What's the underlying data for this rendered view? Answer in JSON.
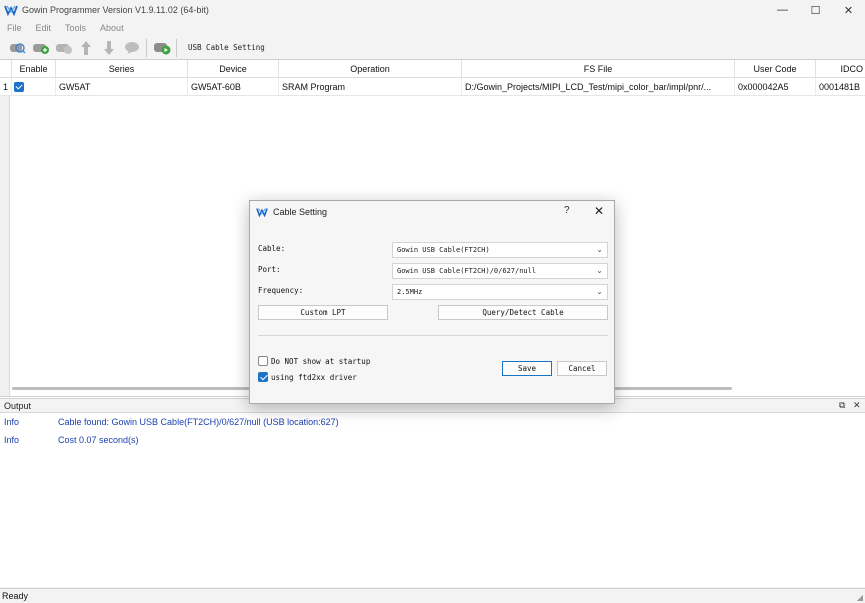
{
  "window": {
    "title": "Gowin Programmer Version V1.9.11.02 (64-bit)",
    "minimize": "—",
    "maximize": "☐",
    "close": "✕"
  },
  "menu": [
    "File",
    "Edit",
    "Tools",
    "About"
  ],
  "toolbar": {
    "label": "USB Cable Setting"
  },
  "table": {
    "headers": [
      "Enable",
      "Series",
      "Device",
      "Operation",
      "FS File",
      "User Code",
      "IDCO"
    ],
    "rows": [
      {
        "num": "1",
        "enabled": true,
        "series": "GW5AT",
        "device": "GW5AT-60B",
        "operation": "SRAM Program",
        "fs_file": "D:/Gowin_Projects/MIPI_LCD_Test/mipi_color_bar/impl/pnr/...",
        "user_code": "0x000042A5",
        "idcode": "0001481B"
      }
    ]
  },
  "output": {
    "title": "Output",
    "float_icon": "⧉",
    "close_icon": "✕",
    "logs": [
      {
        "type": "Info",
        "message": "Cable found:  Gowin USB Cable(FT2CH)/0/627/null (USB location:627)"
      },
      {
        "type": "Info",
        "message": "Cost 0.07 second(s)"
      }
    ]
  },
  "status": {
    "text": "Ready"
  },
  "dialog": {
    "title": "Cable Setting",
    "help": "?",
    "close": "✕",
    "cable_label": "Cable:",
    "cable_value": "Gowin USB Cable(FT2CH)",
    "port_label": "Port:",
    "port_value": "Gowin USB Cable(FT2CH)/0/627/null",
    "frequency_label": "Frequency:",
    "frequency_value": "2.5MHz",
    "custom_lpt": "Custom LPT",
    "query_detect": "Query/Detect Cable",
    "dont_show_label": "Do NOT show at startup",
    "dont_show_checked": false,
    "ftd2xx_label": "using ftd2xx driver",
    "ftd2xx_checked": true,
    "save": "Save",
    "cancel": "Cancel"
  },
  "colors": {
    "accent": "#1a73c8",
    "log_text": "#1a3fb0"
  }
}
